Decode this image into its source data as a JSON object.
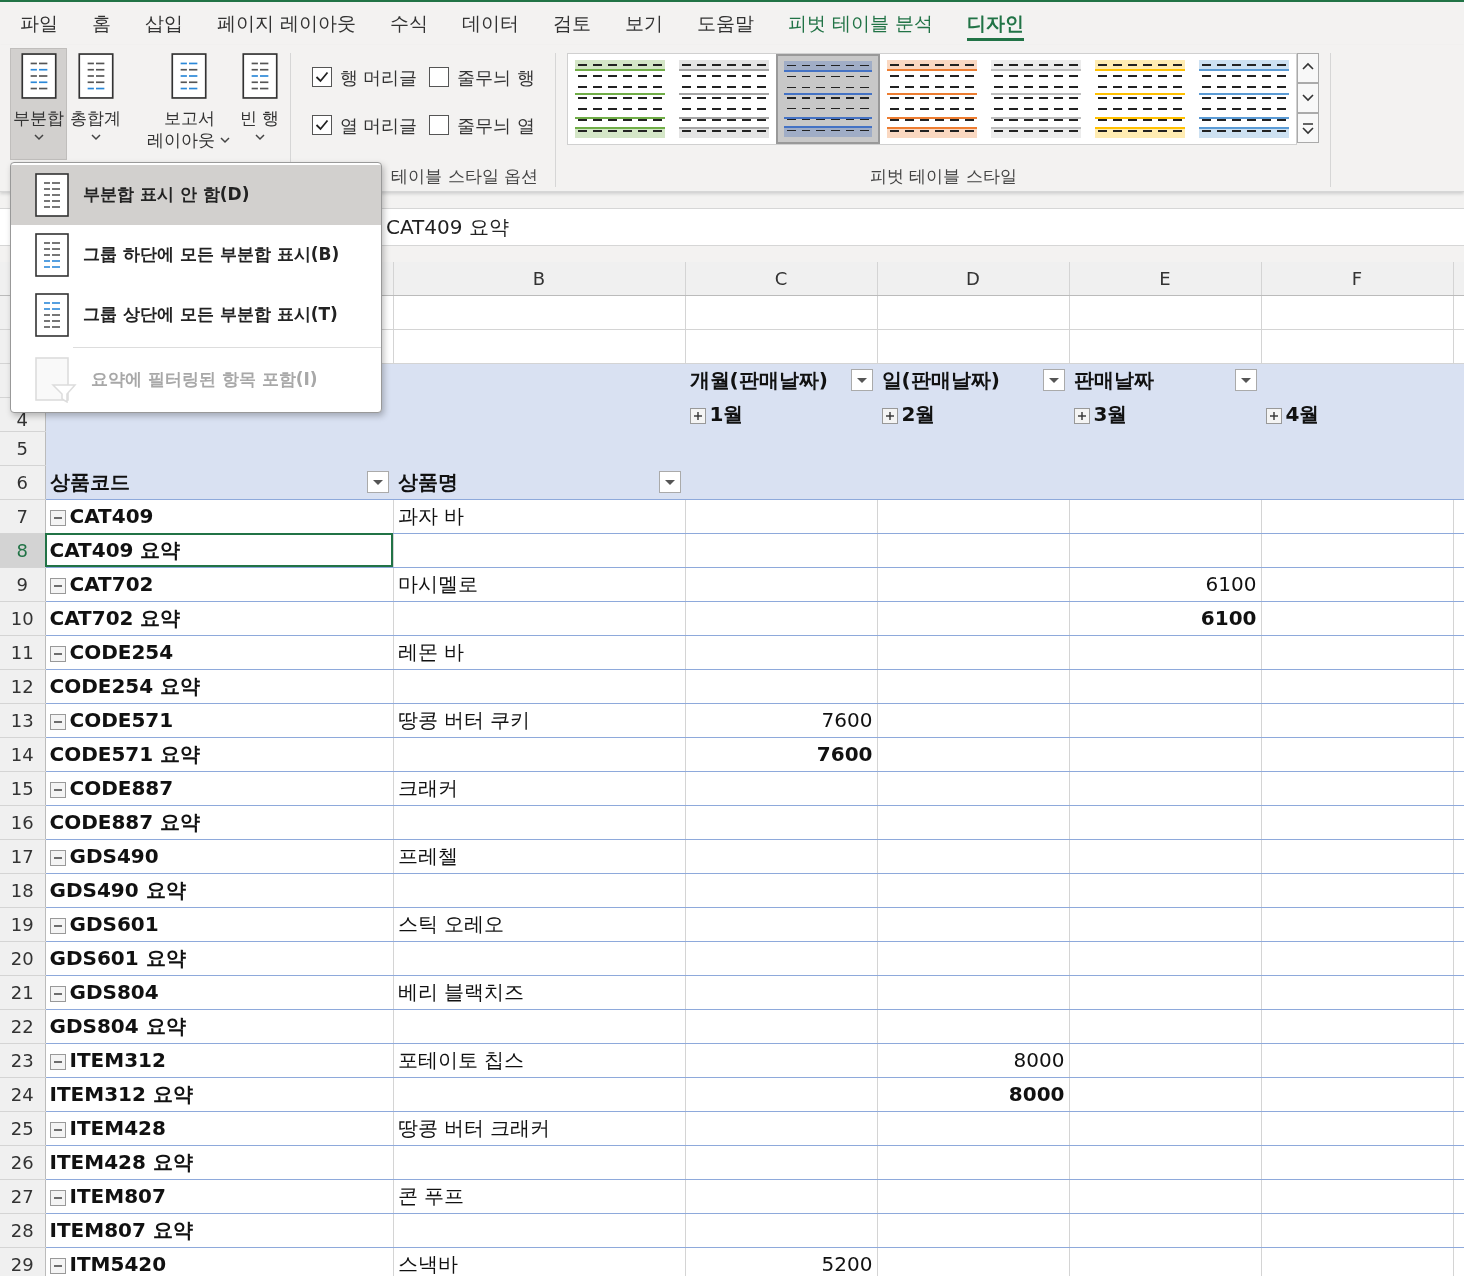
{
  "ribbon_tabs": [
    {
      "label": "파일",
      "selected": false,
      "contextual": false
    },
    {
      "label": "홈",
      "selected": false,
      "contextual": false
    },
    {
      "label": "삽입",
      "selected": false,
      "contextual": false
    },
    {
      "label": "페이지 레이아웃",
      "selected": false,
      "contextual": false
    },
    {
      "label": "수식",
      "selected": false,
      "contextual": false
    },
    {
      "label": "데이터",
      "selected": false,
      "contextual": false
    },
    {
      "label": "검토",
      "selected": false,
      "contextual": false
    },
    {
      "label": "보기",
      "selected": false,
      "contextual": false
    },
    {
      "label": "도움말",
      "selected": false,
      "contextual": false
    },
    {
      "label": "피벗 테이블 분석",
      "selected": false,
      "contextual": true
    },
    {
      "label": "디자인",
      "selected": true,
      "contextual": true
    }
  ],
  "layout_buttons": [
    {
      "lines": [
        "부분합"
      ],
      "pressed": true
    },
    {
      "lines": [
        "총합계"
      ],
      "pressed": false
    },
    {
      "lines": [
        "보고서",
        "레이아웃"
      ],
      "pressed": false
    },
    {
      "lines": [
        "빈 행"
      ],
      "pressed": false
    }
  ],
  "style_options": {
    "checkboxes": [
      {
        "label": "행 머리글",
        "checked": true
      },
      {
        "label": "줄무늬 행",
        "checked": false
      },
      {
        "label": "열 머리글",
        "checked": true
      },
      {
        "label": "줄무늬 열",
        "checked": false
      }
    ],
    "group_label": "테이블 스타일 옵션"
  },
  "pivot_styles": {
    "swatches": [
      {
        "color": "#70ad47",
        "selected": false
      },
      {
        "color": "#a5a5a5",
        "selected": false
      },
      {
        "color": "#4472c4",
        "selected": true
      },
      {
        "color": "#ed7d31",
        "selected": false
      },
      {
        "color": "#bfbfbf",
        "selected": false
      },
      {
        "color": "#ffc000",
        "selected": false
      },
      {
        "color": "#5b9bd5",
        "selected": false
      }
    ],
    "group_label": "피벗 테이블 스타일"
  },
  "subtotal_menu": {
    "items": [
      {
        "label": "부분합 표시 안 함(D)",
        "kind": "none",
        "selected": true,
        "disabled": false
      },
      {
        "label": "그룹 하단에 모든 부분합 표시(B)",
        "kind": "bottom",
        "selected": false,
        "disabled": false
      },
      {
        "label": "그룹 상단에 모든 부분합 표시(T)",
        "kind": "top",
        "selected": false,
        "disabled": false
      },
      {
        "label": "요약에 필터링된 항목 포함(I)",
        "kind": "filter",
        "selected": false,
        "disabled": true
      }
    ]
  },
  "formula_bar": {
    "value": "CAT409 요약"
  },
  "sheet": {
    "columns": [
      "B",
      "C",
      "D",
      "E",
      "F"
    ],
    "pivot_header": {
      "row_numbers": [
        "4",
        "5",
        "6"
      ],
      "column_fields": [
        {
          "label": "개월(판매날짜)"
        },
        {
          "label": "일(판매날짜)"
        },
        {
          "label": "판매날짜"
        }
      ],
      "months": [
        {
          "label": "1월",
          "expanded": false
        },
        {
          "label": "2월",
          "expanded": false
        },
        {
          "label": "3월",
          "expanded": false
        },
        {
          "label": "4월",
          "expanded": false
        }
      ],
      "row_fields": [
        {
          "label": "상품코드"
        },
        {
          "label": "상품명"
        }
      ]
    },
    "rows": [
      {
        "number": "7",
        "kind": "item",
        "code": "CAT409",
        "name": "과자 바",
        "expanded": true
      },
      {
        "number": "8",
        "kind": "summary",
        "code": "CAT409 요약",
        "selected": true
      },
      {
        "number": "9",
        "kind": "item",
        "code": "CAT702",
        "name": "마시멜로",
        "expanded": true,
        "values": {
          "E": "6100"
        }
      },
      {
        "number": "10",
        "kind": "summary",
        "code": "CAT702 요약",
        "selected": false,
        "values": {
          "E": "6100"
        }
      },
      {
        "number": "11",
        "kind": "item",
        "code": "CODE254",
        "name": "레몬 바",
        "expanded": true
      },
      {
        "number": "12",
        "kind": "summary",
        "code": "CODE254 요약",
        "selected": false
      },
      {
        "number": "13",
        "kind": "item",
        "code": "CODE571",
        "name": "땅콩 버터 쿠키",
        "expanded": true,
        "values": {
          "C": "7600"
        }
      },
      {
        "number": "14",
        "kind": "summary",
        "code": "CODE571 요약",
        "selected": false,
        "values": {
          "C": "7600"
        }
      },
      {
        "number": "15",
        "kind": "item",
        "code": "CODE887",
        "name": "크래커",
        "expanded": true
      },
      {
        "number": "16",
        "kind": "summary",
        "code": "CODE887 요약",
        "selected": false
      },
      {
        "number": "17",
        "kind": "item",
        "code": "GDS490",
        "name": "프레첼",
        "expanded": true
      },
      {
        "number": "18",
        "kind": "summary",
        "code": "GDS490 요약",
        "selected": false
      },
      {
        "number": "19",
        "kind": "item",
        "code": "GDS601",
        "name": "스틱 오레오",
        "expanded": true
      },
      {
        "number": "20",
        "kind": "summary",
        "code": "GDS601 요약",
        "selected": false
      },
      {
        "number": "21",
        "kind": "item",
        "code": "GDS804",
        "name": "베리 블랙치즈",
        "expanded": true
      },
      {
        "number": "22",
        "kind": "summary",
        "code": "GDS804 요약",
        "selected": false
      },
      {
        "number": "23",
        "kind": "item",
        "code": "ITEM312",
        "name": "포테이토 칩스",
        "expanded": true,
        "values": {
          "D": "8000"
        }
      },
      {
        "number": "24",
        "kind": "summary",
        "code": "ITEM312 요약",
        "selected": false,
        "values": {
          "D": "8000"
        }
      },
      {
        "number": "25",
        "kind": "item",
        "code": "ITEM428",
        "name": "땅콩 버터 크래커",
        "expanded": true
      },
      {
        "number": "26",
        "kind": "summary",
        "code": "ITEM428 요약",
        "selected": false
      },
      {
        "number": "27",
        "kind": "item",
        "code": "ITEM807",
        "name": "콘 푸프",
        "expanded": true
      },
      {
        "number": "28",
        "kind": "summary",
        "code": "ITEM807 요약",
        "selected": false
      },
      {
        "number": "29",
        "kind": "item",
        "code": "ITM5420",
        "name": "스낵바",
        "expanded": true,
        "values": {
          "C": "5200"
        }
      }
    ]
  }
}
